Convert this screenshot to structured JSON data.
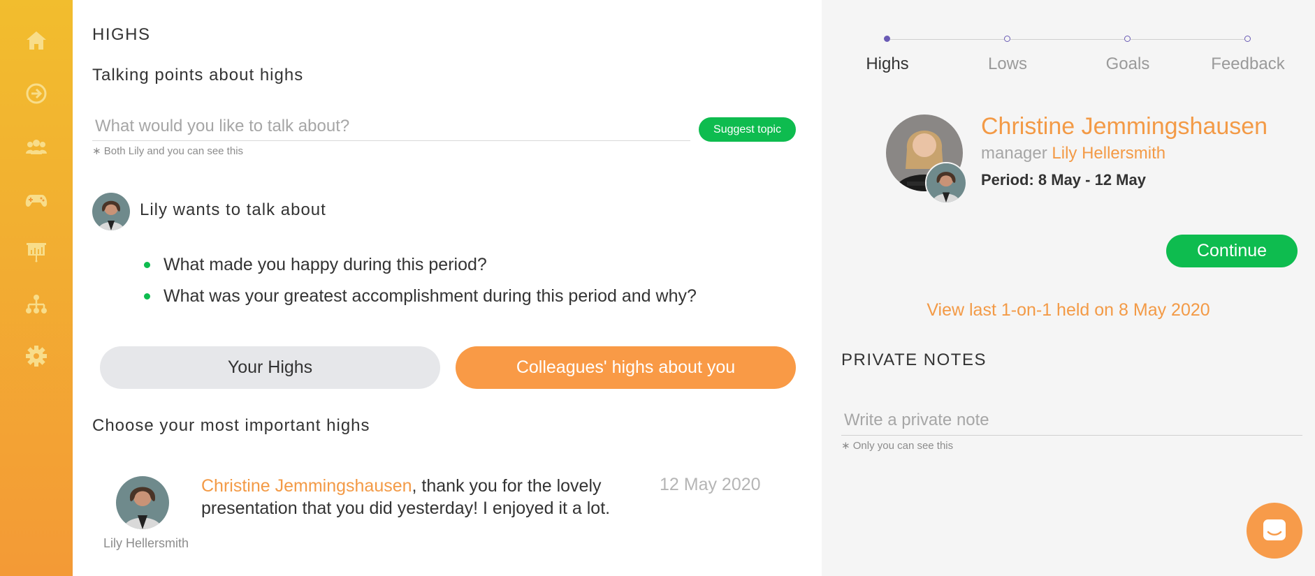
{
  "sidebar": {
    "items": [
      {
        "name": "home-icon"
      },
      {
        "name": "arrow-circle-icon"
      },
      {
        "name": "people-icon"
      },
      {
        "name": "gamepad-icon"
      },
      {
        "name": "presentation-icon"
      },
      {
        "name": "org-chart-icon"
      },
      {
        "name": "gear-icon"
      }
    ]
  },
  "main": {
    "section_title": "HIGHS",
    "talking_points_title": "Talking points about highs",
    "topic_placeholder": "What would you like to talk about?",
    "suggest_label": "Suggest topic",
    "topic_hint": "∗ Both Lily and you can see this",
    "lily_title": "Lily wants to talk about",
    "bullets": [
      "What made you happy during this period?",
      "What was your greatest accomplishment during this period and why?"
    ],
    "tabs": {
      "your_highs": "Your Highs",
      "colleagues": "Colleagues' highs about you"
    },
    "choose_title": "Choose your most important highs",
    "high_item": {
      "name": "Christine Jemmingshausen",
      "message": ", thank you for the lovely presentation that you did yesterday! I enjoyed it a lot.",
      "date": "12 May 2020",
      "author": "Lily Hellersmith"
    }
  },
  "right": {
    "steps": [
      {
        "label": "Highs",
        "active": true
      },
      {
        "label": "Lows",
        "active": false
      },
      {
        "label": "Goals",
        "active": false
      },
      {
        "label": "Feedback",
        "active": false
      }
    ],
    "profile": {
      "name": "Christine Jemmingshausen",
      "manager_prefix": "manager",
      "manager_name": "Lily Hellersmith",
      "period": "Period: 8 May - 12 May"
    },
    "continue_label": "Continue",
    "view_last": "View last 1-on-1 held on 8 May 2020",
    "private_notes_title": "PRIVATE NOTES",
    "private_placeholder": "Write a private note",
    "private_hint": "∗ Only you can see this"
  },
  "colors": {
    "accent_orange": "#f39a46",
    "accent_green": "#0ebc4f",
    "stepper_purple": "#6a5bb5",
    "sidebar_top": "#f2bd2e",
    "sidebar_bottom": "#f39a36"
  }
}
